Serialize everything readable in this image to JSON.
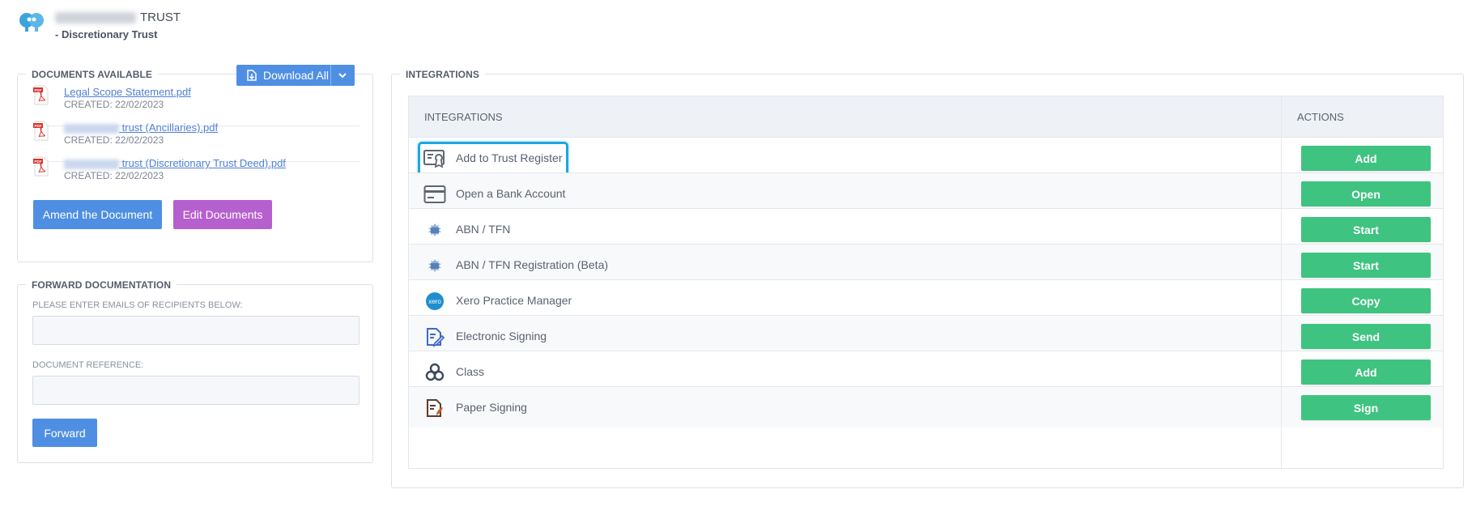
{
  "header": {
    "title_suffix": "TRUST",
    "subtitle": "- Discretionary Trust"
  },
  "documents": {
    "legend": "DOCUMENTS AVAILABLE",
    "download_label": "Download All",
    "items": [
      {
        "name": "Legal Scope Statement.pdf",
        "created": "CREATED: 22/02/2023"
      },
      {
        "name": "trust (Ancillaries).pdf",
        "created": "CREATED: 22/02/2023"
      },
      {
        "name": "trust (Discretionary Trust Deed).pdf",
        "created": "CREATED: 22/02/2023"
      }
    ],
    "amend_label": "Amend the Document",
    "edit_label": "Edit Documents"
  },
  "forward": {
    "legend": "FORWARD DOCUMENTATION",
    "emails_label": "PLEASE ENTER EMAILS OF RECIPIENTS BELOW:",
    "emails_value": "",
    "reference_label": "DOCUMENT REFERENCE:",
    "reference_value": "",
    "forward_label": "Forward"
  },
  "integrations": {
    "legend": "INTEGRATIONS",
    "col_integrations": "INTEGRATIONS",
    "col_actions": "ACTIONS",
    "rows": [
      {
        "icon": "certificate-icon",
        "label": "Add to Trust Register",
        "action": "Add"
      },
      {
        "icon": "bank-card-icon",
        "label": "Open a Bank Account",
        "action": "Open"
      },
      {
        "icon": "coat-of-arms-icon",
        "label": "ABN / TFN",
        "action": "Start"
      },
      {
        "icon": "coat-of-arms-icon",
        "label": "ABN / TFN Registration (Beta)",
        "action": "Start"
      },
      {
        "icon": "xero-icon",
        "label": "Xero Practice Manager",
        "action": "Copy"
      },
      {
        "icon": "e-sign-icon",
        "label": "Electronic Signing",
        "action": "Send"
      },
      {
        "icon": "class-icon",
        "label": "Class",
        "action": "Add"
      },
      {
        "icon": "paper-sign-icon",
        "label": "Paper Signing",
        "action": "Sign"
      }
    ]
  },
  "colors": {
    "primary": "#4f8fe3",
    "purple": "#b660cf",
    "green": "#3fc380",
    "highlight": "#1ba8e0"
  }
}
